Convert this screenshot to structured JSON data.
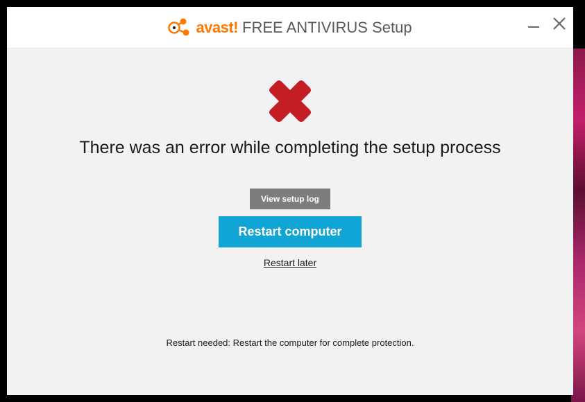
{
  "titlebar": {
    "brand": "avast!",
    "suffix": "FREE ANTIVIRUS Setup"
  },
  "content": {
    "heading": "There was an error while completing the setup process",
    "view_log_label": "View setup log",
    "restart_label": "Restart computer",
    "restart_later_label": "Restart later"
  },
  "footer": {
    "message": "Restart needed: Restart the computer for complete protection."
  }
}
